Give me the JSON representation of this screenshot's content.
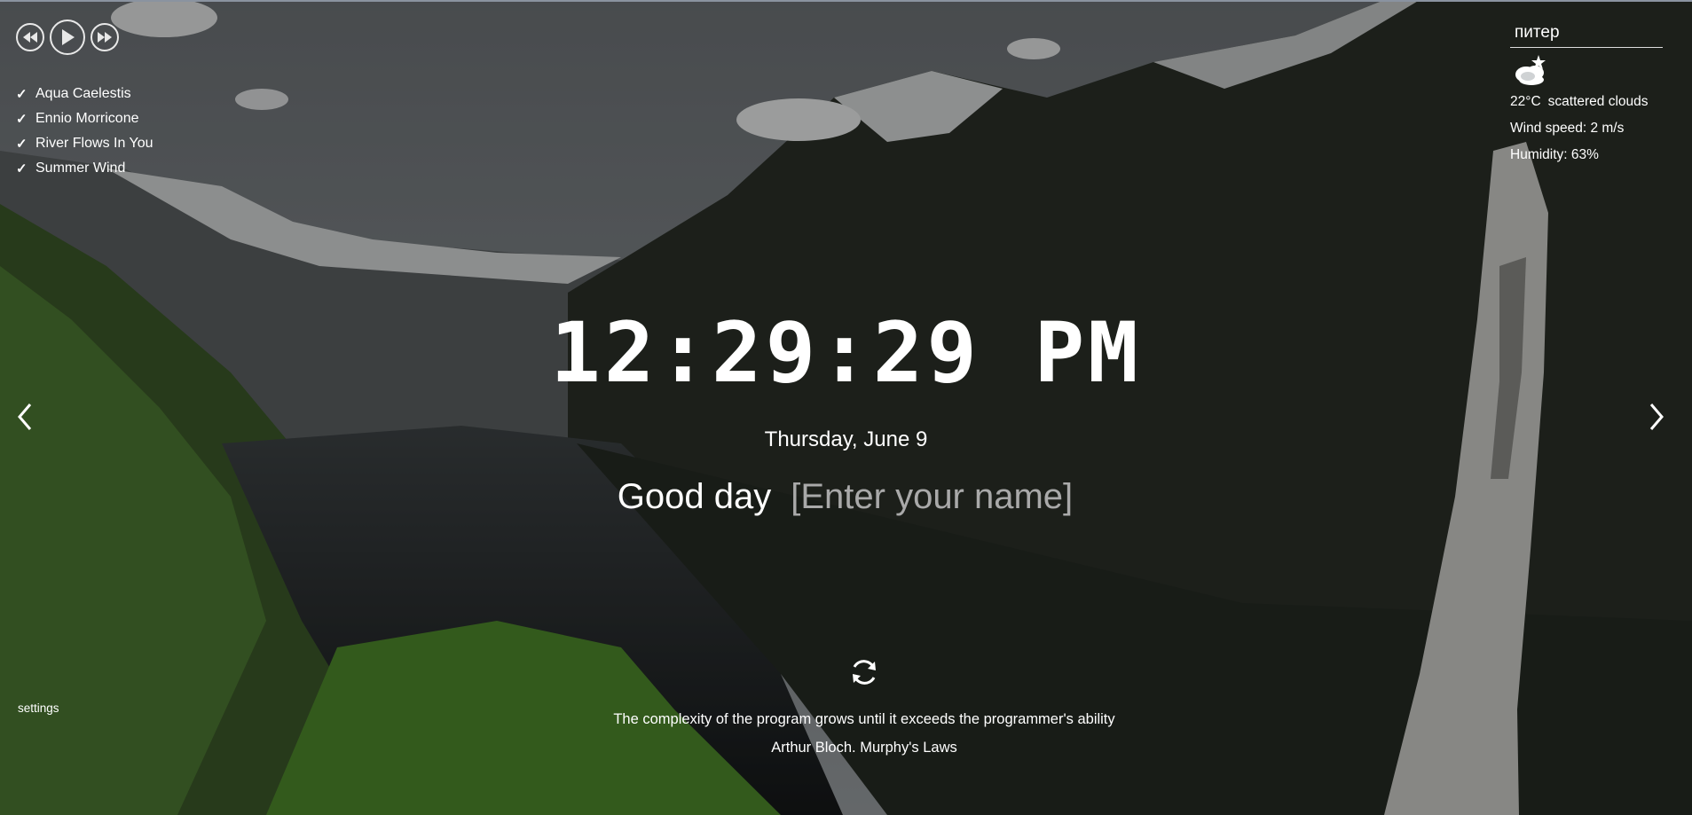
{
  "player": {
    "prev_icon": "rewind-icon",
    "play_icon": "play-icon",
    "next_icon": "fast-forward-icon"
  },
  "playlist": [
    {
      "title": "Aqua Caelestis"
    },
    {
      "title": "Ennio Morricone"
    },
    {
      "title": "River Flows In You"
    },
    {
      "title": "Summer Wind"
    }
  ],
  "weather": {
    "city": "питер",
    "icon": "scattered-clouds-icon",
    "temperature": "22°C",
    "description": "scattered clouds",
    "wind": "Wind speed: 2 m/s",
    "humidity": "Humidity: 63%"
  },
  "clock": {
    "time": "12:29:29 PM",
    "date": "Thursday, June 9"
  },
  "greeting": {
    "text": "Good day",
    "name_placeholder": "[Enter your name]"
  },
  "quote": {
    "text": "The complexity of the program grows until it exceeds the programmer's ability",
    "author": "Arthur Bloch. Murphy's Laws"
  },
  "settings": {
    "label": "settings"
  },
  "colors": {
    "text": "#ffffff",
    "placeholder": "#a9a9a9"
  }
}
